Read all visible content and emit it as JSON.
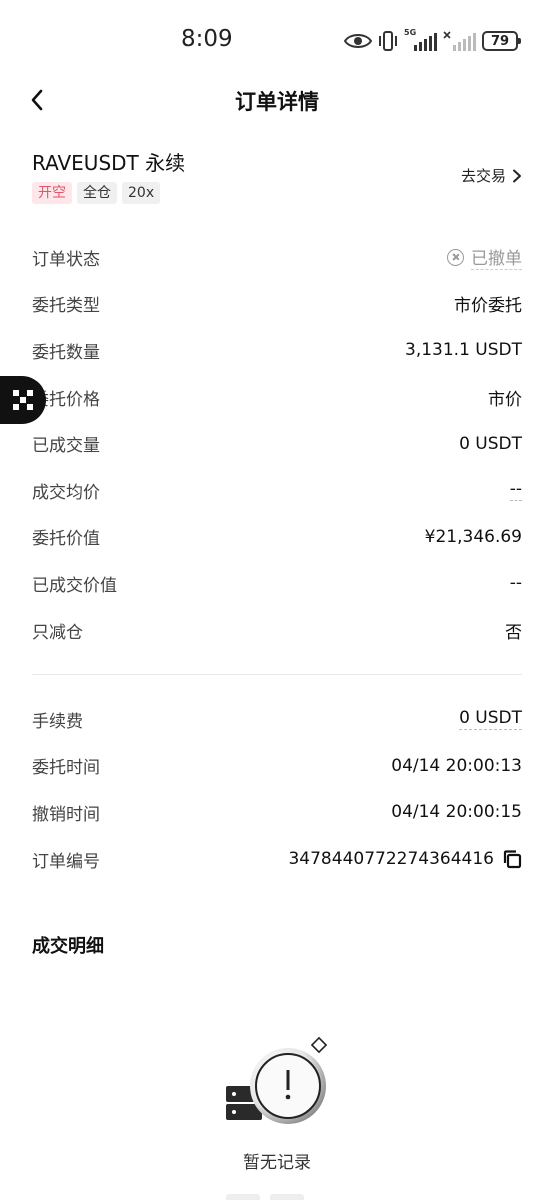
{
  "status_bar": {
    "time": "8:09",
    "signal_tag_1": "5G",
    "battery": "79",
    "icons": [
      "eye-icon",
      "vibrate-icon",
      "signal-5g-icon",
      "signal-weak-icon",
      "battery-icon"
    ]
  },
  "header": {
    "title": "订单详情",
    "back_icon": "chevron-left-icon"
  },
  "instrument": {
    "symbol": "RAVEUSDT 永续",
    "tags": [
      "开空",
      "全仓",
      "20x"
    ],
    "trade_link": "去交易",
    "accent_open": "#e0566b"
  },
  "order_rows": [
    {
      "label": "订单状态",
      "value": "已撤单"
    },
    {
      "label": "委托类型",
      "value": "市价委托"
    },
    {
      "label": "委托数量",
      "value": "3,131.1 USDT"
    },
    {
      "label": "委托价格",
      "value": "市价"
    },
    {
      "label": "已成交量",
      "value": "0 USDT"
    },
    {
      "label": "成交均价",
      "value": "--"
    },
    {
      "label": "委托价值",
      "value": "¥21,346.69"
    },
    {
      "label": "已成交价值",
      "value": "--"
    },
    {
      "label": "只减仓",
      "value": "否"
    }
  ],
  "fee_rows": [
    {
      "label": "手续费",
      "value": "0 USDT"
    },
    {
      "label": "委托时间",
      "value": "04/14 20:00:13"
    },
    {
      "label": "撤销时间",
      "value": "04/14 20:00:15"
    },
    {
      "label": "订单编号",
      "value": "3478440772274364416"
    }
  ],
  "details": {
    "title": "成交明细",
    "empty_text": "暂无记录"
  }
}
